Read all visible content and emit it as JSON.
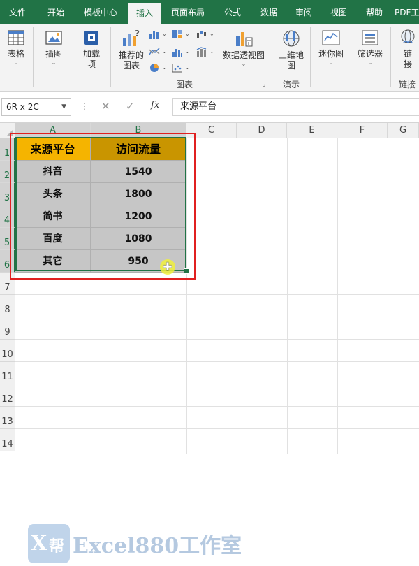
{
  "ribbon_tabs": [
    "文件",
    "开始",
    "模板中心",
    "插入",
    "页面布局",
    "公式",
    "数据",
    "审阅",
    "视图",
    "帮助",
    "PDF工"
  ],
  "active_tab": "插入",
  "ribbon": {
    "table": "表格",
    "illustrations": "插图",
    "addins_line1": "加载",
    "addins_line2": "项",
    "recommended_line1": "推荐的",
    "recommended_line2": "图表",
    "pivot_chart": "数据透视图",
    "map3d_line1": "三维地",
    "map3d_line2": "图",
    "sparkline": "迷你图",
    "filter": "筛选器",
    "link_line1": "链",
    "link_line2": "接",
    "group_charts": "图表",
    "group_tours": "演示",
    "group_links": "链接"
  },
  "formula_bar": {
    "name_box": "6R x 2C",
    "formula": "来源平台"
  },
  "columns": [
    "A",
    "B",
    "C",
    "D",
    "E",
    "F",
    "G"
  ],
  "rows": [
    "1",
    "2",
    "3",
    "4",
    "5",
    "6",
    "7",
    "8",
    "9",
    "10",
    "11",
    "12",
    "13",
    "14"
  ],
  "table": {
    "headers": [
      "来源平台",
      "访问流量"
    ],
    "rows": [
      [
        "抖音",
        "1540"
      ],
      [
        "头条",
        "1800"
      ],
      [
        "简书",
        "1200"
      ],
      [
        "百度",
        "1080"
      ],
      [
        "其它",
        "950"
      ]
    ]
  },
  "watermark": {
    "badge_letter": "X",
    "badge_char": "帮",
    "text": "Excel880工作室"
  },
  "colors": {
    "ribbon_green": "#217346",
    "header_orange": "#f5b400",
    "header_dark_orange": "#c99500",
    "body_gray": "#c6c6c6",
    "highlight_red": "#e02020"
  }
}
